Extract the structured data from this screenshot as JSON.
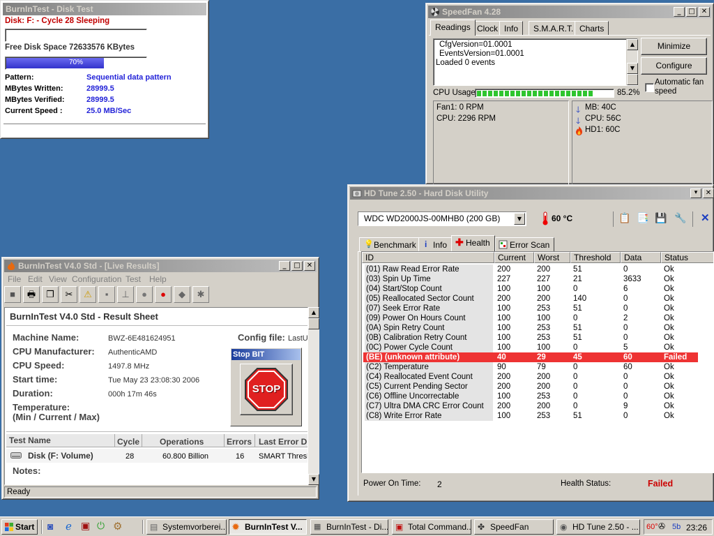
{
  "disk_test": {
    "title": "BurnInTest - Disk Test",
    "status": "Disk: F: - Cycle 28 Sleeping",
    "free_space": "Free Disk Space 72633576 KBytes",
    "progress_label": "70%",
    "progress_value": 0.7,
    "pattern_label": "Pattern:",
    "pattern_value": "Sequential data pattern",
    "written_label": "MBytes Written:",
    "written_value": "28999.5",
    "verified_label": "MBytes Verified:",
    "verified_value": "28999.5",
    "speed_label": "Current Speed :",
    "speed_value": "25.0 MB/Sec"
  },
  "speedfan": {
    "title": "SpeedFan 4.28",
    "tabs": [
      "Readings",
      "Clock",
      "Info",
      "S.M.A.R.T.",
      "Charts"
    ],
    "log_lines": [
      "CfgVersion=01.0001",
      "EventsVersion=01.0001",
      "Loaded 0 events"
    ],
    "minimize_label": "Minimize",
    "configure_label": "Configure",
    "auto_speed_label": "Automatic fan speed",
    "cpu_usage_label": "CPU Usage",
    "cpu_usage_value": "85.2%",
    "cpu_usage_fraction": 0.852,
    "fan_lines": [
      "Fan1: 0 RPM",
      "CPU:  2296 RPM"
    ],
    "temps": [
      {
        "label": "MB:   40C",
        "icon": "arrow-down-icon"
      },
      {
        "label": "CPU: 56C",
        "icon": "arrow-down-icon"
      },
      {
        "label": "HD1: 60C",
        "icon": "flame-icon"
      }
    ]
  },
  "hdtune": {
    "title": "HD Tune 2.50 - Hard Disk Utility",
    "drive": "WDC WD2000JS-00MHB0 (200 GB)",
    "temperature": "60 °C",
    "tabs": [
      "Benchmark",
      "Info",
      "Health",
      "Error Scan"
    ],
    "columns": [
      "ID",
      "Current",
      "Worst",
      "Threshold",
      "Data",
      "Status"
    ],
    "rows": [
      [
        "(01) Raw Read Error Rate",
        "200",
        "200",
        "51",
        "0",
        "Ok"
      ],
      [
        "(03) Spin Up Time",
        "227",
        "227",
        "21",
        "3633",
        "Ok"
      ],
      [
        "(04) Start/Stop Count",
        "100",
        "100",
        "0",
        "6",
        "Ok"
      ],
      [
        "(05) Reallocated Sector Count",
        "200",
        "200",
        "140",
        "0",
        "Ok"
      ],
      [
        "(07) Seek Error Rate",
        "100",
        "253",
        "51",
        "0",
        "Ok"
      ],
      [
        "(09) Power On Hours Count",
        "100",
        "100",
        "0",
        "2",
        "Ok"
      ],
      [
        "(0A) Spin Retry Count",
        "100",
        "253",
        "51",
        "0",
        "Ok"
      ],
      [
        "(0B) Calibration Retry Count",
        "100",
        "253",
        "51",
        "0",
        "Ok"
      ],
      [
        "(0C) Power Cycle Count",
        "100",
        "100",
        "0",
        "5",
        "Ok"
      ],
      [
        "(BE) (unknown attribute)",
        "40",
        "29",
        "45",
        "60",
        "Failed"
      ],
      [
        "(C2) Temperature",
        "90",
        "79",
        "0",
        "60",
        "Ok"
      ],
      [
        "(C4) Reallocated Event Count",
        "200",
        "200",
        "0",
        "0",
        "Ok"
      ],
      [
        "(C5) Current Pending Sector",
        "200",
        "200",
        "0",
        "0",
        "Ok"
      ],
      [
        "(C6) Offline Uncorrectable",
        "100",
        "253",
        "0",
        "0",
        "Ok"
      ],
      [
        "(C7) Ultra DMA CRC Error Count",
        "200",
        "200",
        "0",
        "9",
        "Ok"
      ],
      [
        "(C8) Write Error Rate",
        "100",
        "253",
        "51",
        "0",
        "Ok"
      ]
    ],
    "failed_row_index": 9,
    "power_on_label": "Power On Time:",
    "power_on_value": "2",
    "health_label": "Health Status:",
    "health_value": "Failed",
    "colors": {
      "failed_bg": "#ee3333",
      "failed_text": "#cc0000"
    }
  },
  "burnintest": {
    "title": "BurnInTest V4.0 Std - [Live Results]",
    "menu": [
      "File",
      "Edit",
      "View",
      "Configuration",
      "Test",
      "Help"
    ],
    "sheet_title": "BurnInTest V4.0 Std - Result Sheet",
    "machine_label": "Machine Name:",
    "machine_value": "BWZ-6E481624951",
    "cpu_manu_label": "CPU Manufacturer:",
    "cpu_manu_value": "AuthenticAMD",
    "cpu_speed_label": "CPU Speed:",
    "cpu_speed_value": "1497.8 MHz",
    "start_label": "Start time:",
    "start_value": "Tue May 23 23:08:30 2006",
    "duration_label": "Duration:",
    "duration_value": "000h 17m 46s",
    "temp_label_1": "Temperature:",
    "temp_label_2": "(Min / Current / Max)",
    "config_label": "Config file:",
    "config_value": "LastU",
    "stop_title": "Stop BIT",
    "stop_label": "STOP",
    "table_headers": [
      "Test Name",
      "Cycle",
      "Operations",
      "Errors",
      "Last Error D"
    ],
    "row": {
      "name": "Disk (F:  Volume)",
      "cycle": "28",
      "ops": "60.800 Billion",
      "errors": "16",
      "last": "SMART Thresh"
    },
    "notes_label": "Notes:",
    "status": "Ready"
  },
  "taskbar": {
    "start": "Start",
    "tasks": [
      {
        "label": "Systemvorberei...",
        "active": false
      },
      {
        "label": "BurnInTest V...",
        "active": true
      },
      {
        "label": "BurnInTest - Di...",
        "active": false
      },
      {
        "label": "Total Command...",
        "active": false
      },
      {
        "label": "SpeedFan",
        "active": false
      },
      {
        "label": "HD Tune 2.50 - ...",
        "active": false
      }
    ],
    "tray_temp": "60°",
    "tray_b": "5b",
    "clock": "23:26"
  }
}
